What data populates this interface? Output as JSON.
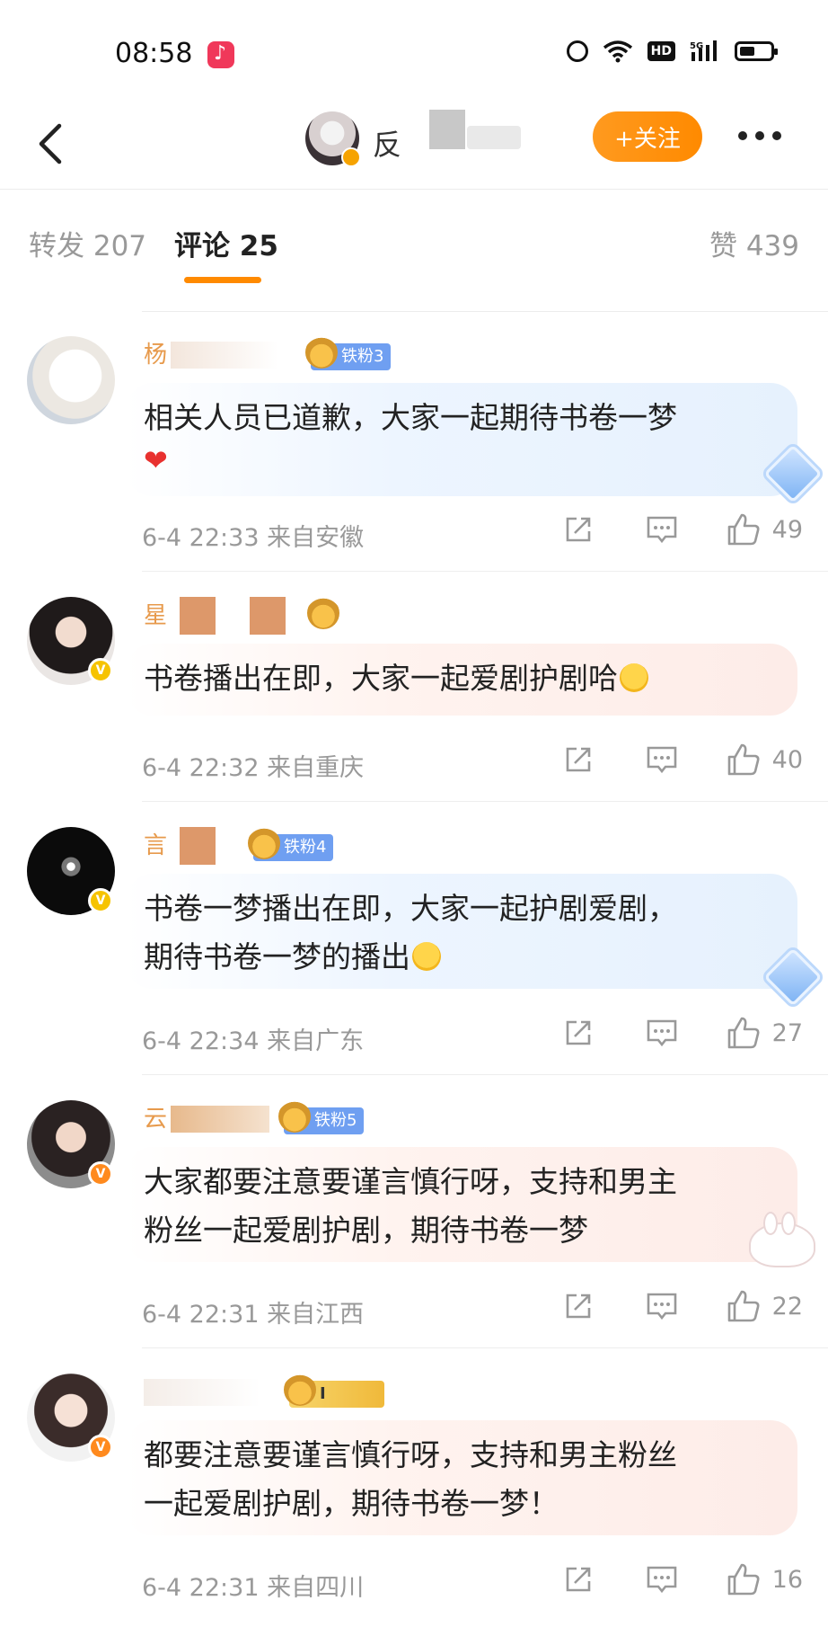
{
  "status_bar": {
    "time": "08:58",
    "icons": [
      "music-app-icon",
      "alarm-icon",
      "wifi-icon",
      "hd-icon",
      "5g-signal-icon",
      "battery-icon"
    ],
    "hd_label": "HD"
  },
  "header": {
    "back_icon": "chevron-left-icon",
    "user_name_visible": "反",
    "follow_label": "+关注",
    "more_icon": "ellipsis-icon",
    "accent_color": "#ff8a00"
  },
  "tabs": {
    "repost": "转发 207",
    "comments": "评论 25",
    "likes": "赞 439",
    "active": "comments"
  },
  "comments": [
    {
      "name_visible": "杨",
      "badge": "铁粉3",
      "text": "相关人员已道歉，大家一起期待书卷一梦",
      "has_heart": true,
      "time": "6-4 22:33",
      "location": "来自安徽",
      "likes": "49",
      "bubble": "blue"
    },
    {
      "name_visible": "星",
      "badge": "",
      "text": "书卷播出在即，大家一起爱剧护剧哈",
      "has_heart": false,
      "time": "6-4 22:32",
      "location": "来自重庆",
      "likes": "40",
      "bubble": "pink"
    },
    {
      "name_visible": "言",
      "badge": "铁粉4",
      "text_line1": "书卷一梦播出在即，大家一起护剧爱剧，",
      "text_line2": "期待书卷一梦的播出",
      "time": "6-4 22:34",
      "location": "来自广东",
      "likes": "27",
      "bubble": "blue"
    },
    {
      "name_visible": "云",
      "badge": "铁粉5",
      "text_line1": "大家都要注意要谨言慎行呀，支持和男主",
      "text_line2": "粉丝一起爱剧护剧，期待书卷一梦",
      "time": "6-4 22:31",
      "location": "来自江西",
      "likes": "22",
      "bubble": "pink"
    },
    {
      "name_visible": "",
      "badge": "I",
      "text_line1": "都要注意要谨言慎行呀，支持和男主粉丝",
      "text_line2": "一起爱剧护剧，期待书卷一梦！",
      "time": "6-4 22:31",
      "location": "来自四川",
      "likes": "16",
      "bubble": "pink"
    }
  ]
}
